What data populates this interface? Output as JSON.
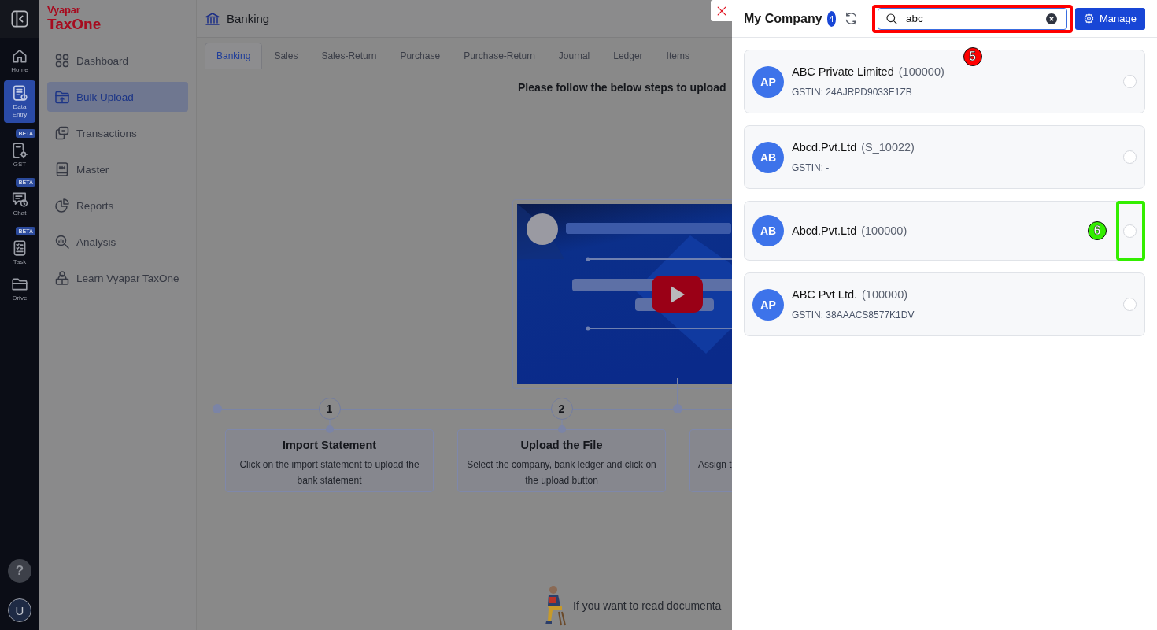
{
  "rail": {
    "items": [
      {
        "label": "Home",
        "selected": false
      },
      {
        "label": "Data Entry",
        "selected": true
      },
      {
        "label": "GST",
        "selected": false,
        "badge": "BETA"
      },
      {
        "label": "Chat",
        "selected": false,
        "badge": "BETA"
      },
      {
        "label": "Task",
        "selected": false,
        "badge": "BETA"
      },
      {
        "label": "Drive",
        "selected": false
      }
    ],
    "help": "?",
    "user": "U"
  },
  "sidebar": {
    "logo": {
      "top": "Vyapar",
      "bottom": "TaxOne"
    },
    "items": [
      {
        "label": "Dashboard",
        "selected": false
      },
      {
        "label": "Bulk Upload",
        "selected": true
      },
      {
        "label": "Transactions",
        "selected": false
      },
      {
        "label": "Master",
        "selected": false
      },
      {
        "label": "Reports",
        "selected": false
      },
      {
        "label": "Analysis",
        "selected": false
      },
      {
        "label": "Learn Vyapar TaxOne",
        "selected": false
      }
    ]
  },
  "page": {
    "title": "Banking",
    "tabs": [
      {
        "label": "Banking",
        "selected": true
      },
      {
        "label": "Sales",
        "selected": false
      },
      {
        "label": "Sales-Return",
        "selected": false
      },
      {
        "label": "Purchase",
        "selected": false
      },
      {
        "label": "Purchase-Return",
        "selected": false
      },
      {
        "label": "Journal",
        "selected": false
      },
      {
        "label": "Ledger",
        "selected": false
      },
      {
        "label": "Items",
        "selected": false
      }
    ],
    "instruction": "Please follow the below steps to upload",
    "steps": [
      {
        "number": "1",
        "title": "Import Statement",
        "description": "Click on the import statement to upload the bank statement"
      },
      {
        "number": "2",
        "title": "Upload the File",
        "description": "Select the company, bank ledger and click on the upload button"
      },
      {
        "description": "Assign t"
      }
    ],
    "footer_text": "If you want to read documenta"
  },
  "drawer": {
    "title": "My Company",
    "count": "4",
    "search": {
      "value": "abc",
      "annotation": {
        "number": "5",
        "color": "#ff0000"
      }
    },
    "manage_button": "Manage",
    "companies": [
      {
        "initials": "AP",
        "name": "ABC Private Limited",
        "code": "(100000)",
        "gstin": "GSTIN: 24AJRPD9033E1ZB",
        "selected": false
      },
      {
        "initials": "AB",
        "name": "Abcd.Pvt.Ltd",
        "code": "(S_10022)",
        "gstin": "GSTIN: -",
        "selected": false
      },
      {
        "initials": "AB",
        "name": "Abcd.Pvt.Ltd",
        "code": "(100000)",
        "selected": false,
        "annotation": {
          "number": "6",
          "color": "#33ee00"
        }
      },
      {
        "initials": "AP",
        "name": "ABC Pvt Ltd.",
        "code": "(100000)",
        "gstin": "GSTIN: 38AAACS8577K1DV",
        "selected": false
      }
    ]
  }
}
